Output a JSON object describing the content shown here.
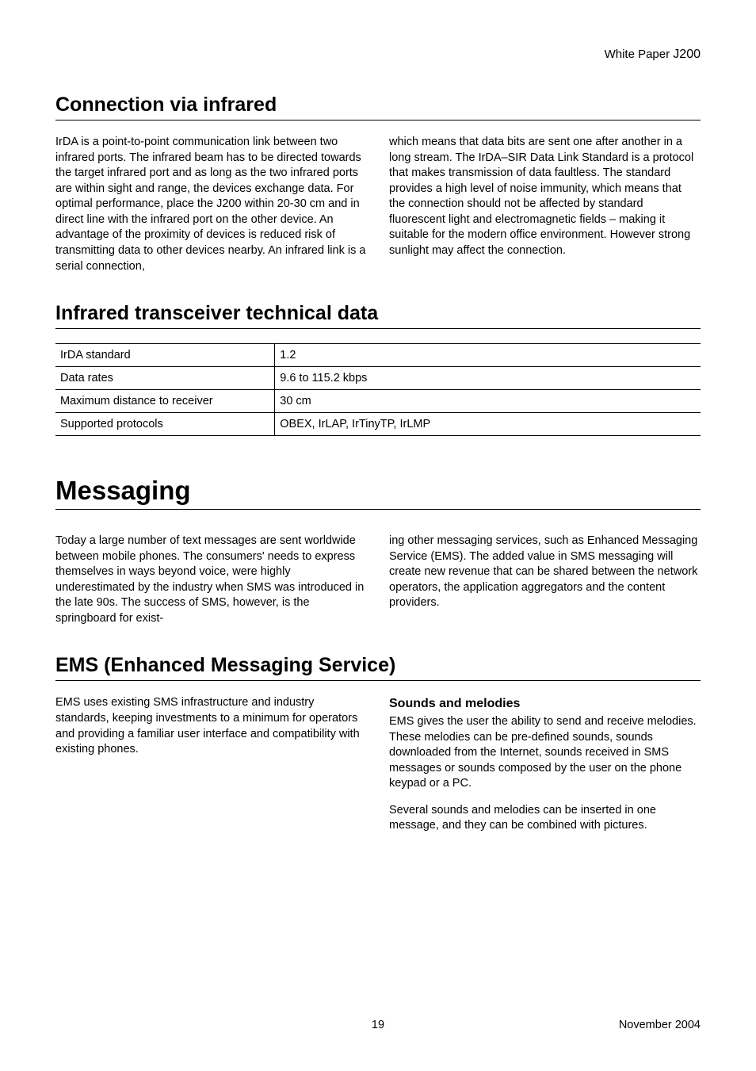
{
  "header": {
    "label": "White Paper ",
    "docId": "J200"
  },
  "sections": {
    "irConnection": {
      "title": "Connection via infrared",
      "col1": "IrDA is a point-to-point communication link between two infrared ports. The infrared beam has to be directed towards the target infrared port and as long as the two infrared ports are within sight and range, the devices exchange data. For optimal performance, place the J200 within 20-30 cm and in direct line with the infrared port on the other device. An advantage of the proximity of devices is reduced risk of transmitting data to other devices nearby. An infrared link is a serial connection,",
      "col2": "which means that data bits are sent one after another in a long stream. The IrDA–SIR Data Link Standard is a protocol that makes transmission of data faultless. The standard provides a high level of noise immunity, which means that the connection should not be affected by standard fluorescent light and electromagnetic fields – making it suitable for the modern office environment. However strong sunlight may affect the connection."
    },
    "irTechData": {
      "title": "Infrared transceiver technical data",
      "rows": [
        {
          "label": "IrDA standard",
          "value": "1.2"
        },
        {
          "label": "Data rates",
          "value": "9.6 to 115.2 kbps"
        },
        {
          "label": "Maximum distance to receiver",
          "value": "30 cm"
        },
        {
          "label": "Supported protocols",
          "value": "OBEX, IrLAP, IrTinyTP, IrLMP"
        }
      ]
    },
    "messaging": {
      "title": "Messaging",
      "col1": "Today a large number of text messages are sent worldwide between mobile phones. The consumers' needs to express themselves in ways beyond voice, were highly underestimated by the industry when SMS was introduced in the late 90s. The success of SMS, however, is the springboard for exist-",
      "col2": "ing other messaging services, such as Enhanced Messaging Service (EMS). The added value in SMS messaging will create new revenue that can be shared between the network operators, the application aggregators and the content providers."
    },
    "ems": {
      "title": "EMS (Enhanced Messaging Service)",
      "col1": "EMS uses existing SMS infrastructure and industry standards, keeping investments to a minimum for operators and providing a familiar user interface and compatibility with existing phones.",
      "col2heading": "Sounds and melodies",
      "col2p1": "EMS gives the user the ability to send and receive melodies. These melodies can be pre-defined sounds, sounds downloaded from the Internet, sounds received in SMS messages or sounds composed by the user on the phone keypad or a PC.",
      "col2p2": "Several sounds and melodies can be inserted in one message, and they can be combined with pictures."
    }
  },
  "footer": {
    "pageNumber": "19",
    "date": "November 2004"
  }
}
